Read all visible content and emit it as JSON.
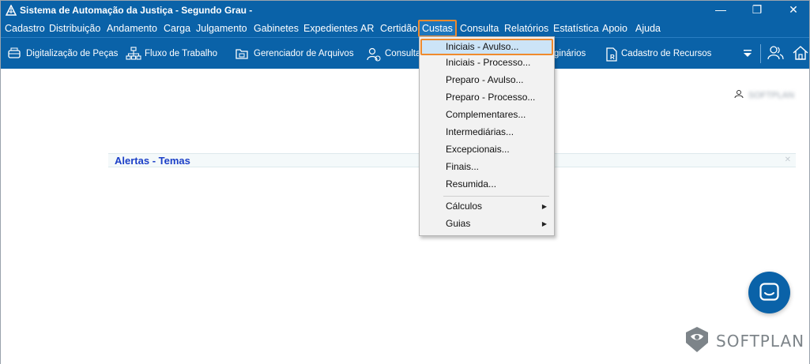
{
  "window": {
    "title": "Sistema de Automação da Justiça - Segundo Grau -",
    "minimize_glyph": "—",
    "restore_glyph": "❐",
    "close_glyph": "✕"
  },
  "menubar": {
    "items": [
      "Cadastro",
      "Distribuição",
      "Andamento",
      "Carga",
      "Julgamento",
      "Gabinetes",
      "Expedientes",
      "AR",
      "Certidão",
      "Custas",
      "Consulta",
      "Relatórios",
      "Estatística",
      "Apoio",
      "Ajuda"
    ],
    "active": "Custas"
  },
  "toolbar": {
    "items": [
      "Digitalização de Peças",
      "Fluxo de Trabalho",
      "Gerenciador de Arquivos",
      "Consulta",
      "ginários",
      "Cadastro de Recursos"
    ]
  },
  "user": {
    "name": "SOFTPLAN"
  },
  "alerts": {
    "title": "Alertas - Temas",
    "close_glyph": "✕"
  },
  "custas_menu": {
    "items": [
      "Iniciais - Avulso...",
      "Iniciais - Processo...",
      "Preparo - Avulso...",
      "Preparo - Processo...",
      "Complementares...",
      "Intermediárias...",
      "Excepcionais...",
      "Finais...",
      "Resumida...",
      "Cálculos",
      "Guias"
    ],
    "highlighted": "Iniciais - Avulso...",
    "submenu_arrow": "▶"
  },
  "logo": {
    "text": "SOFTPLAN"
  },
  "colors": {
    "brand": "#0a62a8",
    "highlight": "#ef8a2d",
    "alert_title": "#1b3fc7"
  },
  "icons": {
    "toolbar": [
      "scanner-icon",
      "workflow-icon",
      "file-manager-icon",
      "consulta-icon",
      "recurso-icon"
    ],
    "right": [
      "dropdown-arrow-icon",
      "users-icon",
      "home-icon"
    ]
  }
}
